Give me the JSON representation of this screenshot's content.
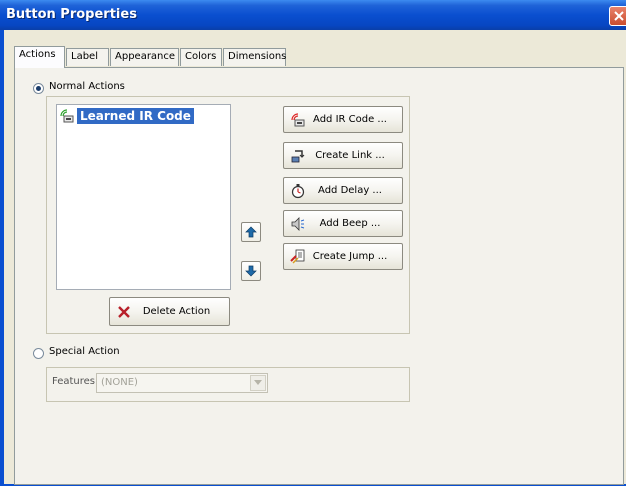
{
  "window": {
    "title": "Button Properties"
  },
  "tabs": [
    {
      "label": "Actions",
      "active": true
    },
    {
      "label": "Label",
      "active": false
    },
    {
      "label": "Appearance",
      "active": false
    },
    {
      "label": "Colors",
      "active": false
    },
    {
      "label": "Dimensions",
      "active": false
    }
  ],
  "normal_actions": {
    "label": "Normal Actions",
    "selected": true,
    "list_items": [
      {
        "label": "Learned IR Code",
        "icon": "ir-code-icon",
        "selected": true
      }
    ],
    "buttons": {
      "add_ir_code": "Add IR Code ...",
      "create_link": "Create Link ...",
      "add_delay": "Add Delay ...",
      "add_beep": "Add Beep ...",
      "create_jump": "Create Jump ...",
      "delete_action": "Delete Action"
    }
  },
  "special_action": {
    "label": "Special Action",
    "selected": false,
    "features_label": "Features:",
    "features_value": "(NONE)"
  },
  "colors": {
    "titlebar": "#0a4fd0",
    "selection": "#316ac5",
    "panel": "#f3f2ec"
  }
}
